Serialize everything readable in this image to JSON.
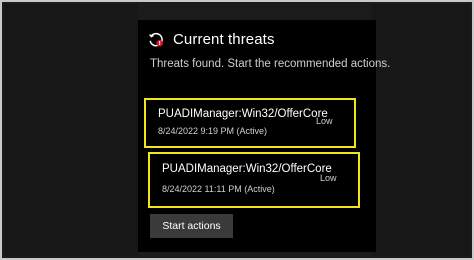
{
  "header": {
    "icon": "threat-history-icon",
    "title": "Current threats",
    "subtitle": "Threats found. Start the recommended actions."
  },
  "threats": [
    {
      "name": "PUADIManager:Win32/OfferCore",
      "timestamp": "8/24/2022 9:19 PM (Active)",
      "severity": "Low"
    },
    {
      "name": "PUADIManager:Win32/OfferCore",
      "timestamp": "8/24/2022 11:11 PM (Active)",
      "severity": "Low"
    }
  ],
  "actions": {
    "start_label": "Start actions"
  },
  "colors": {
    "panel_bg": "#000000",
    "highlight": "#f2e61a",
    "icon_accent": "#e81123",
    "button_bg": "#3a3a3a"
  }
}
